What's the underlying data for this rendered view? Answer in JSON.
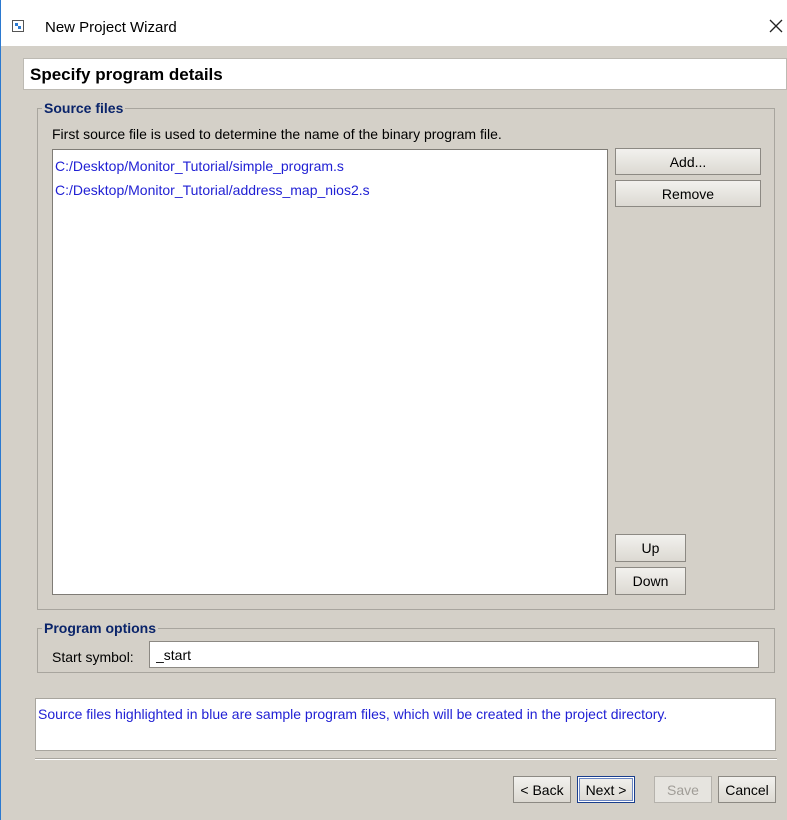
{
  "window": {
    "title": "New Project Wizard"
  },
  "page": {
    "heading": "Specify program details"
  },
  "source_files": {
    "legend": "Source files",
    "hint": "First source file is used to determine the name of the binary program file.",
    "files": [
      "C:/Desktop/Monitor_Tutorial/simple_program.s",
      "C:/Desktop/Monitor_Tutorial/address_map_nios2.s"
    ],
    "add_label": "Add...",
    "remove_label": "Remove",
    "up_label": "Up",
    "down_label": "Down"
  },
  "program_options": {
    "legend": "Program options",
    "start_symbol_label": "Start symbol:",
    "start_symbol_value": "_start"
  },
  "info": {
    "message": "Source files highlighted in blue are sample program files, which will be created in the project directory."
  },
  "footer": {
    "back_label": "< Back",
    "next_label": "Next >",
    "save_label": "Save",
    "cancel_label": "Cancel"
  },
  "colors": {
    "sample_file_text": "#1f1fd4",
    "legend_text": "#0a246a",
    "dialog_background": "#d4d0c8"
  },
  "icons": {
    "app": "app-window-icon",
    "close": "close-icon"
  }
}
